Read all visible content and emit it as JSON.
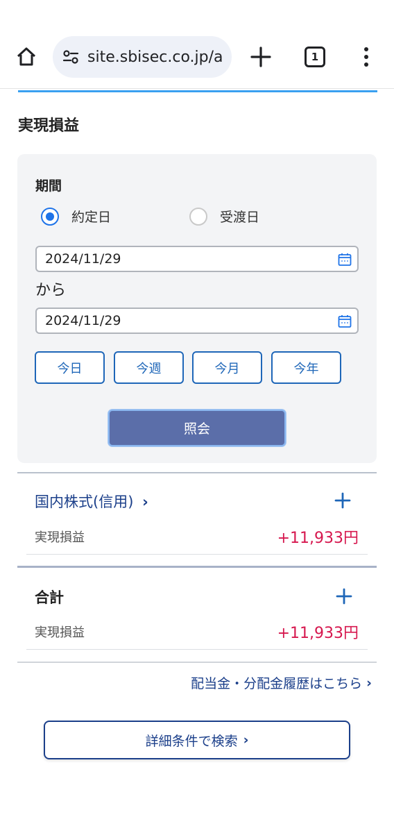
{
  "browser": {
    "url": "site.sbisec.co.jp/a",
    "tab_count": "1"
  },
  "page": {
    "title": "実現損益"
  },
  "filter": {
    "period_label": "期間",
    "radio_options": [
      {
        "label": "約定日",
        "selected": true
      },
      {
        "label": "受渡日",
        "selected": false
      }
    ],
    "date_from": "2024/11/29",
    "connector": "から",
    "date_to": "2024/11/29",
    "quick_buttons": [
      "今日",
      "今週",
      "今月",
      "今年"
    ],
    "query_label": "照会"
  },
  "categories": [
    {
      "name": "国内株式(信用)",
      "pl_label": "実現損益",
      "pl_value": "+11,933円"
    }
  ],
  "total": {
    "label": "合計",
    "pl_label": "実現損益",
    "pl_value": "+11,933円"
  },
  "links": {
    "dividend": "配当金・分配金履歴はこちら",
    "detail_search": "詳細条件で検索"
  },
  "colors": {
    "accent_blue": "#1e66b8",
    "link_navy": "#1b3f8a",
    "profit_red": "#d6174e",
    "query_button": "#5b6ea9"
  }
}
